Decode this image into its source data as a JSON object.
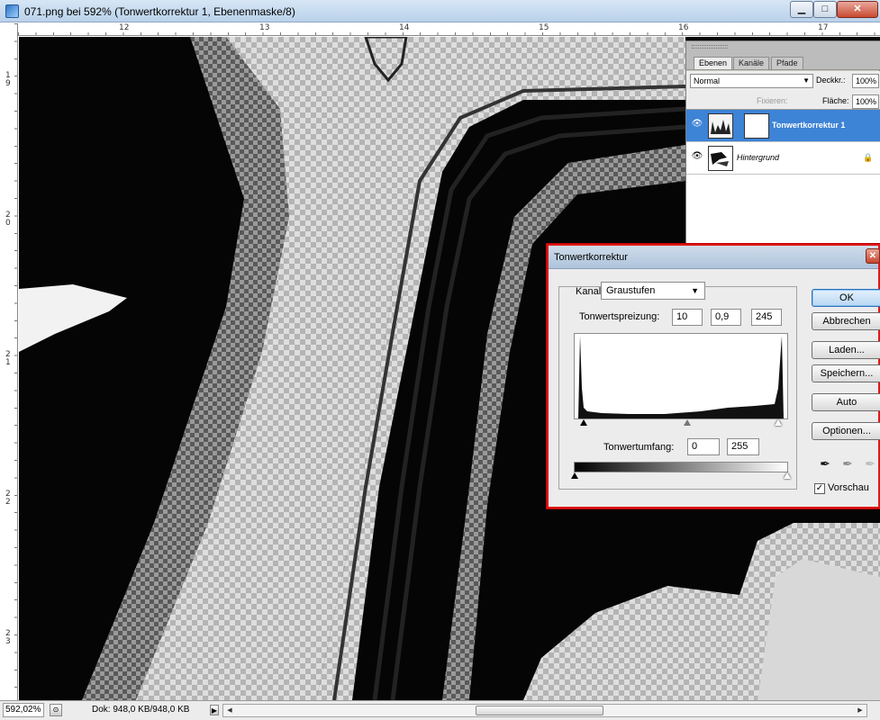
{
  "window": {
    "title": "071.png bei 592% (Tonwertkorrektur 1, Ebenenmaske/8)",
    "min_glyph": "▁",
    "max_glyph": "□",
    "close_glyph": "✕"
  },
  "ruler_top": {
    "ticks": [
      "12",
      "13",
      "14",
      "15",
      "16",
      "17"
    ]
  },
  "ruler_left": {
    "ticks": [
      "19",
      "20",
      "21",
      "22",
      "23"
    ]
  },
  "layers_panel": {
    "tabs": [
      "Ebenen",
      "Kanäle",
      "Pfade"
    ],
    "active_tab": "Ebenen",
    "blend_mode": "Normal",
    "opacity_label": "Deckkr.:",
    "opacity_value": "100%",
    "lock_label": "Fixieren:",
    "fill_label": "Fläche:",
    "fill_value": "100%",
    "layers": [
      {
        "name": "Tonwertkorrektur 1",
        "visible": true,
        "selected": true
      },
      {
        "name": "Hintergrund",
        "visible": true,
        "selected": false,
        "locked": true
      }
    ]
  },
  "levels_dialog": {
    "title": "Tonwertkorrektur",
    "channel_label": "Kanal:",
    "channel_value": "Graustufen",
    "input_levels_label": "Tonwertspreizung:",
    "input_black": "10",
    "input_gamma": "0,9",
    "input_white": "245",
    "output_levels_label": "Tonwertumfang:",
    "output_black": "0",
    "output_white": "255",
    "buttons": {
      "ok": "OK",
      "cancel": "Abbrechen",
      "load": "Laden...",
      "save": "Speichern...",
      "auto": "Auto",
      "options": "Optionen..."
    },
    "preview_label": "Vorschau",
    "preview_checked": true,
    "preview_check_glyph": "✓"
  },
  "status_bar": {
    "zoom": "592,02%",
    "doc_info": "Dok: 948,0 KB/948,0 KB",
    "arrow_glyph": "▶"
  },
  "icons": {
    "eye": "👁",
    "lock": "🔒",
    "dropdown": "▼",
    "eyedropper": "✒"
  }
}
